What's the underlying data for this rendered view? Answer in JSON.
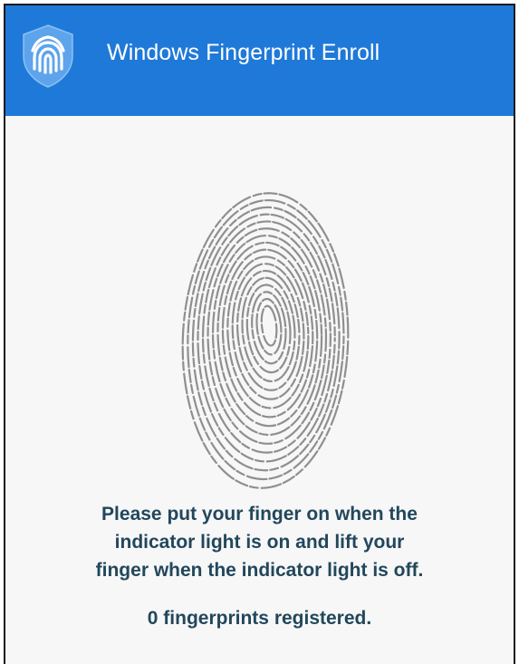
{
  "window": {
    "title": "Windows Fingerprint Enroll",
    "app_icon": "fingerprint-shield-icon",
    "accent_color": "#1f79d8"
  },
  "main": {
    "illustration": "fingerprint-icon",
    "instruction_lines": [
      "Please put your finger on when the",
      "indicator light is on and lift your",
      "finger when the indicator light is off."
    ],
    "status": "0 fingerprints registered.",
    "text_color": "#22475c"
  }
}
